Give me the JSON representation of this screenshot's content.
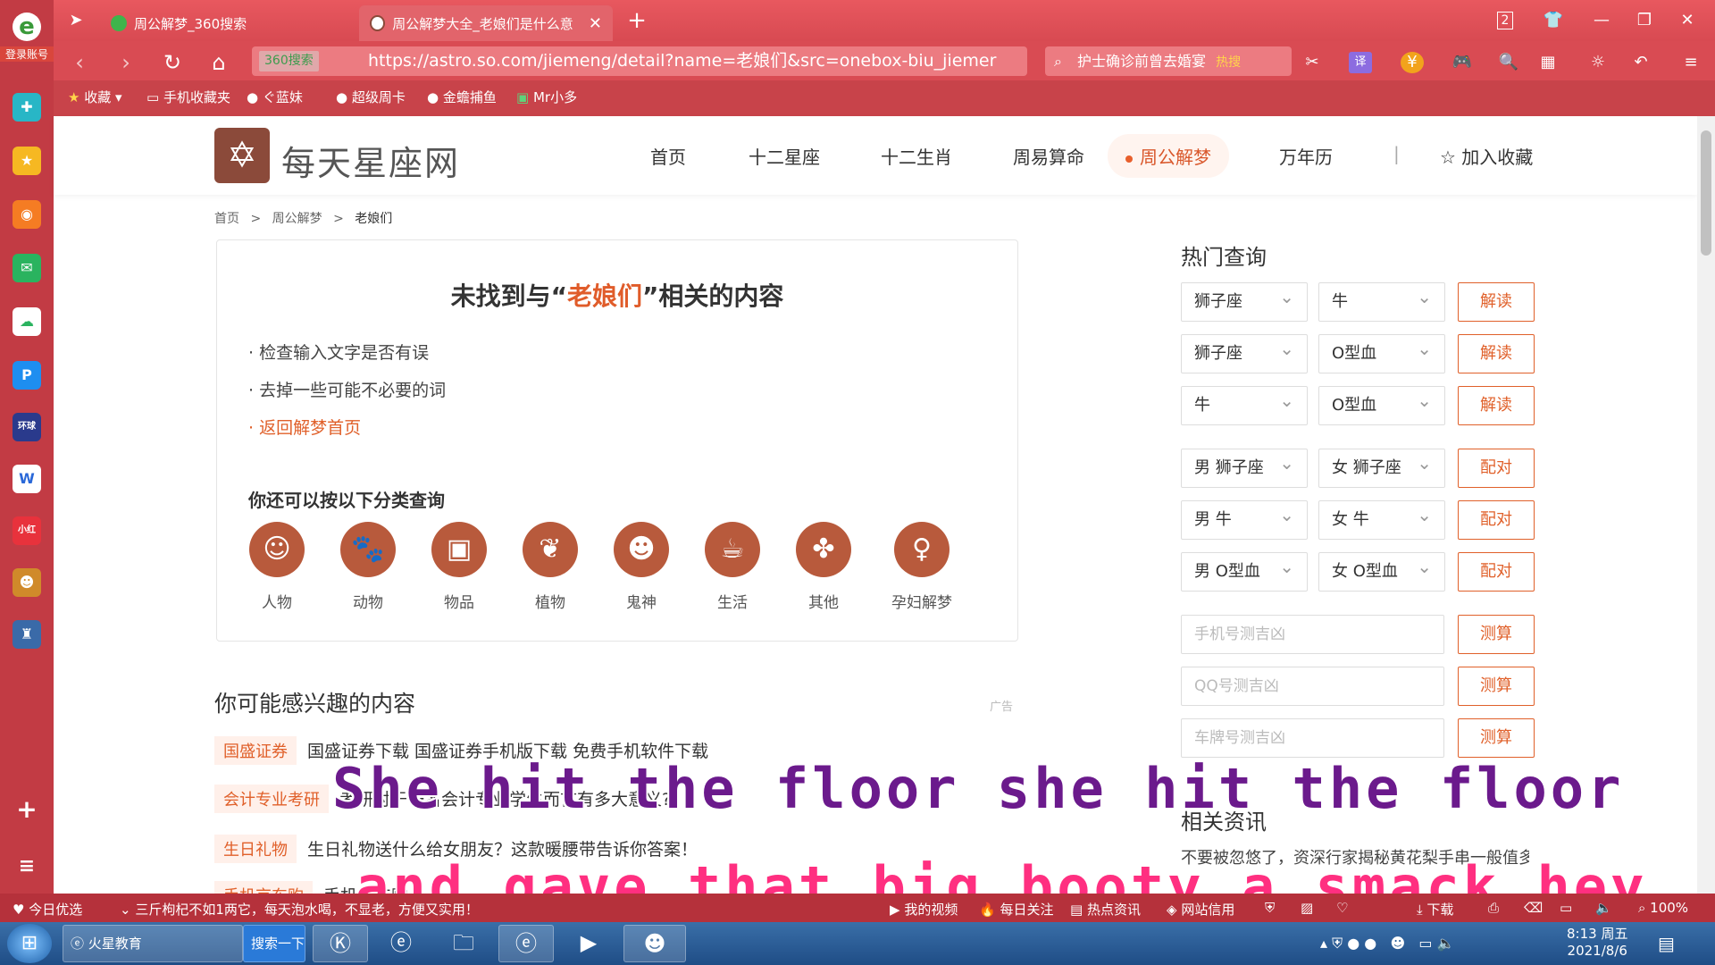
{
  "browser": {
    "tabs": [
      {
        "label": "周公解梦_360搜索"
      },
      {
        "label": "周公解梦大全_老娘们是什么意思"
      }
    ],
    "tab_count": "2",
    "address_badge": "360搜索",
    "url": "https://astro.so.com/jiemeng/detail?name=老娘们&src=onebox-biu_jiemer",
    "search_text": "护士确诊前曾去婚宴",
    "search_hot": "热搜",
    "favorites": [
      "收藏",
      "手机收藏夹",
      "ぐ蓝妹",
      "超级周卡",
      "金蟾捕鱼",
      "Mr小多"
    ]
  },
  "sidebar": {
    "login": "登录账号",
    "items": [
      "plus",
      "star",
      "weibo",
      "mail",
      "cloud",
      "p",
      "news",
      "doc",
      "red",
      "game",
      "game2"
    ]
  },
  "site": {
    "logo": "每天星座网",
    "menu": [
      "首页",
      "十二星座",
      "十二生肖",
      "周易算命",
      "周公解梦",
      "万年历",
      "加入收藏"
    ],
    "breadcrumb": [
      "首页",
      ">",
      "周公解梦",
      ">",
      "老娘们"
    ]
  },
  "notfound": {
    "prefix": "未找到与“",
    "keyword": "老娘们",
    "suffix": "”相关的内容",
    "tips": [
      "· 检查输入文字是否有误",
      "· 去掉一些可能不必要的词",
      "· 返回解梦首页"
    ],
    "category_title": "你还可以按以下分类查询",
    "categories": [
      "人物",
      "动物",
      "物品",
      "植物",
      "鬼神",
      "生活",
      "其他",
      "孕妇解梦"
    ]
  },
  "interest": {
    "title": "你可能感兴趣的内容",
    "ad": "广告",
    "rows": [
      {
        "tag": "国盛证券",
        "text": "国盛证券下载 国盛证券手机版下载 免费手机软件下载"
      },
      {
        "tag": "会计专业考研",
        "text": "考研对于一名会计专业学生而言有多大意义?"
      },
      {
        "tag": "生日礼物",
        "text": "生日礼物送什么给女朋友？这款暖腰带告诉你答案！"
      },
      {
        "tag": "手机京东购",
        "text": "手机京东购"
      }
    ]
  },
  "hot": {
    "title": "热门查询",
    "rows": [
      {
        "a": "狮子座",
        "b": "牛",
        "btn": "解读"
      },
      {
        "a": "狮子座",
        "b": "O型血",
        "btn": "解读"
      },
      {
        "a": "牛",
        "b": "O型血",
        "btn": "解读"
      },
      {
        "a": "男 狮子座",
        "b": "女 狮子座",
        "btn": "配对"
      },
      {
        "a": "男 牛",
        "b": "女 牛",
        "btn": "配对"
      },
      {
        "a": "男 O型血",
        "b": "女 O型血",
        "btn": "配对"
      }
    ],
    "inputs": [
      {
        "placeholder": "手机号测吉凶",
        "btn": "测算"
      },
      {
        "placeholder": "QQ号测吉凶",
        "btn": "测算"
      },
      {
        "placeholder": "车牌号测吉凶",
        "btn": "测算"
      }
    ],
    "related_title": "相关资讯",
    "related_text": "不要被忽悠了，资深行家揭秘黄花梨手串一般值多"
  },
  "subtitles": {
    "line1": "She hit the floor she hit the floor",
    "line2": "and gave that big booty a smack hey"
  },
  "statusbar": {
    "left": "今日优选",
    "news": "三斤枸杞不如1两它，每天泡水喝，不显老，方便又实用！",
    "items": [
      "我的视频",
      "每日关注",
      "热点资讯",
      "网站信用",
      "下载",
      "100%"
    ]
  },
  "taskbar": {
    "apps": [
      "火星教育",
      "搜索一下"
    ],
    "time": "8:13 周五",
    "date": "2021/8/6"
  }
}
